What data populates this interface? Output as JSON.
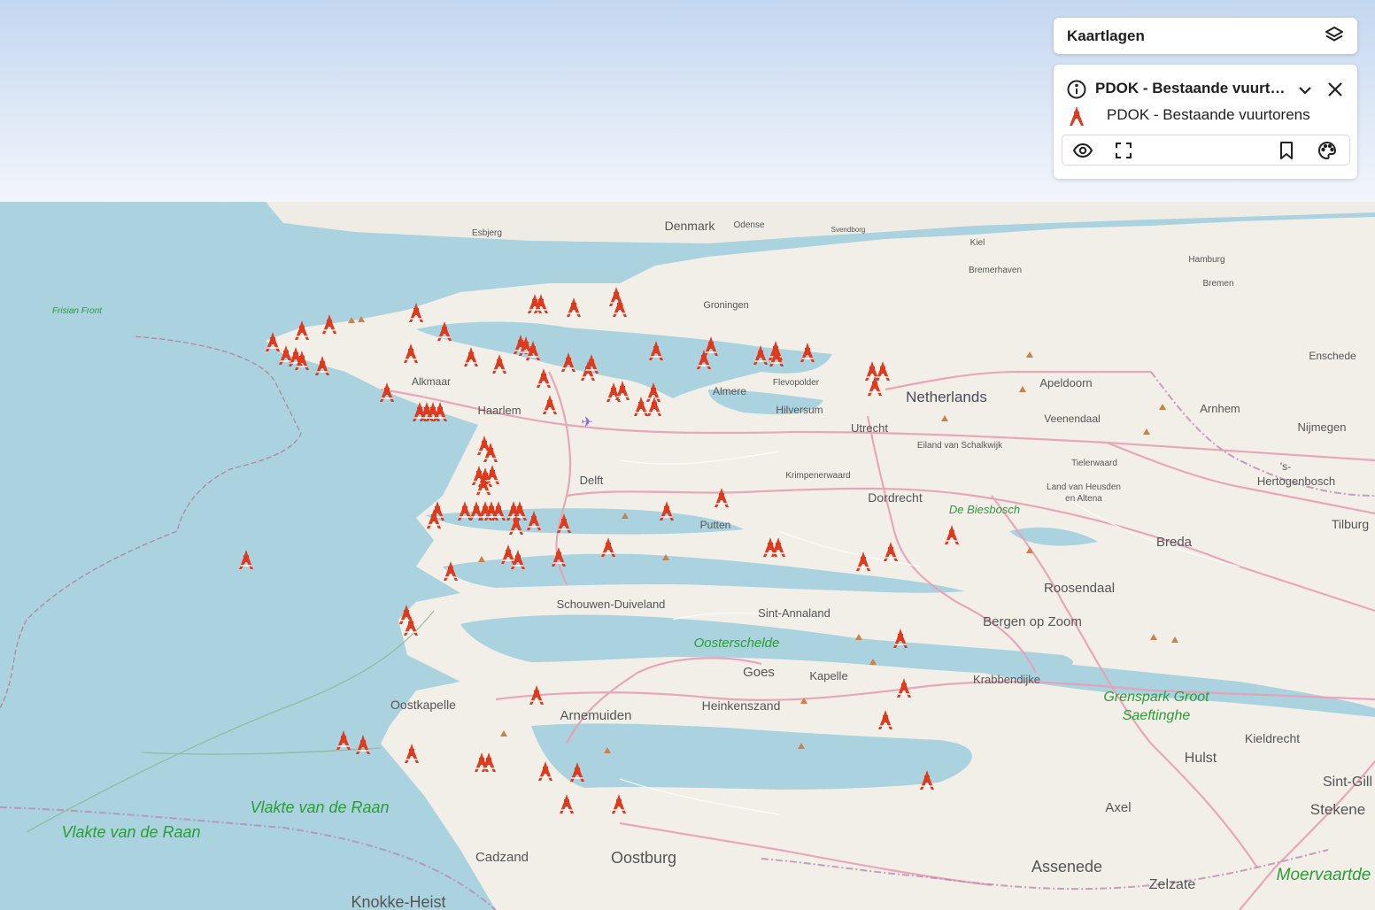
{
  "panel": {
    "header_title": "Kaartlagen",
    "layer_title": "PDOK - Bestaande vuurtorens",
    "legend_label": "PDOK - Bestaande vuurtorens",
    "icons": [
      "layers-icon",
      "info-icon",
      "chevron-down-icon",
      "close-icon",
      "lighthouse-icon",
      "eye-icon",
      "zoom-to-extent-icon",
      "bookmark-icon",
      "palette-icon"
    ]
  },
  "map": {
    "colors": {
      "sea": "#aad3df",
      "land": "#f2efe9",
      "water_label": "#2a9d36",
      "marker": "#e03a1e"
    },
    "labels": {
      "denmark": "Denmark",
      "esbjerg": "Esbjerg",
      "odense": "Odense",
      "svendborg": "Svendborg",
      "kiel": "Kiel",
      "bremerhaven": "Bremerhaven",
      "hamburg": "Hamburg",
      "bremen": "Bremen",
      "frisian_front": "Frisian Front",
      "groningen": "Groningen",
      "enschede": "Enschede",
      "alkmaar": "Alkmaar",
      "flevopolder": "Flevopolder",
      "almere": "Almere",
      "netherlands": "Netherlands",
      "apeldoorn": "Apeldoorn",
      "haarlem": "Haarlem",
      "hilversum": "Hilversum",
      "veenendaal": "Veenendaal",
      "arnhem": "Arnhem",
      "utrecht": "Utrecht",
      "eiland": "Eiland van Schalkwijk",
      "nijmegen": "Nijmegen",
      "tielerwaard": "Tielerwaard",
      "s_": "'s-",
      "hertogenbosch": "Hertogenbosch",
      "delft": "Delft",
      "krimpenerwaard": "Krimpenerwaard",
      "land_heusden": "Land van Heusden",
      "en_altena": "en Altena",
      "dordrecht": "Dordrecht",
      "biesbosch": "De Biesbosch",
      "tilburg": "Tilburg",
      "putten": "Putten",
      "breda": "Breda",
      "roosendaal": "Roosendaal",
      "schouwen": "Schouwen-Duiveland",
      "sint_annaland": "Sint-Annaland",
      "bergen": "Bergen op Zoom",
      "oosterschelde": "Oosterschelde",
      "goes": "Goes",
      "kapelle": "Kapelle",
      "krabbendijke": "Krabbendijke",
      "grenspark1": "Grenspark Groot",
      "grenspark2": "Saeftinghe",
      "oostkapelle": "Oostkapelle",
      "arnemuiden": "Arnemuiden",
      "heinkenszand": "Heinkenszand",
      "kieldrecht": "Kieldrecht",
      "hulst": "Hulst",
      "sint_gill": "Sint-Gill",
      "stekene": "Stekene",
      "vlakte1": "Vlakte van de Raan",
      "vlakte2": "Vlakte van de Raan",
      "axel": "Axel",
      "cadzand": "Cadzand",
      "oostburg": "Oostburg",
      "assenede": "Assenede",
      "zelzate": "Zelzate",
      "moervaart": "Moervaartde",
      "knokke": "Knokke-Heist"
    }
  }
}
